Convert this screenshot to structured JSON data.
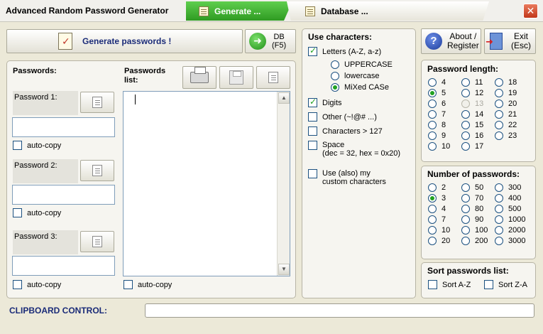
{
  "title": "Advanced Random Password Generator",
  "tabs": [
    {
      "label": "Generate ...",
      "active": true
    },
    {
      "label": "Database ...",
      "active": false
    }
  ],
  "toolbar": {
    "generate_label": "Generate passwords !",
    "db_line1": "DB",
    "db_line2": "(F5)",
    "about_line1": "About /",
    "about_line2": "Register",
    "exit_line1": "Exit",
    "exit_line2": "(Esc)"
  },
  "passwords": {
    "heading": "Passwords:",
    "list_heading_line1": "Passwords",
    "list_heading_line2": "list:",
    "items": [
      {
        "label": "Password 1:",
        "value": "",
        "autocopy_label": "auto-copy",
        "autocopy": false
      },
      {
        "label": "Password 2:",
        "value": "",
        "autocopy_label": "auto-copy",
        "autocopy": false
      },
      {
        "label": "Password 3:",
        "value": "",
        "autocopy_label": "auto-copy",
        "autocopy": false
      }
    ],
    "list_autocopy_label": "auto-copy",
    "list_text": ""
  },
  "use_chars": {
    "heading": "Use characters:",
    "letters": {
      "label": "Letters (A-Z, a-z)",
      "checked": true
    },
    "case_options": [
      {
        "label": "UPPERCASE",
        "selected": false
      },
      {
        "label": "lowercase",
        "selected": false
      },
      {
        "label": "MiXed CASe",
        "selected": true
      }
    ],
    "digits": {
      "label": "Digits",
      "checked": true
    },
    "other": {
      "label": "Other (~!@# ...)",
      "checked": false
    },
    "gt127": {
      "label": "Characters > 127",
      "checked": false
    },
    "space": {
      "label_line1": "Space",
      "label_line2": "(dec = 32, hex = 0x20)",
      "checked": false
    },
    "custom": {
      "label_line1": "Use (also) my",
      "label_line2": "custom characters",
      "checked": false
    }
  },
  "password_length": {
    "heading": "Password length:",
    "options": [
      {
        "label": "4",
        "selected": false,
        "disabled": false
      },
      {
        "label": "11",
        "selected": false,
        "disabled": false
      },
      {
        "label": "18",
        "selected": false,
        "disabled": false
      },
      {
        "label": "5",
        "selected": true,
        "disabled": false
      },
      {
        "label": "12",
        "selected": false,
        "disabled": false
      },
      {
        "label": "19",
        "selected": false,
        "disabled": false
      },
      {
        "label": "6",
        "selected": false,
        "disabled": false
      },
      {
        "label": "13",
        "selected": false,
        "disabled": true
      },
      {
        "label": "20",
        "selected": false,
        "disabled": false
      },
      {
        "label": "7",
        "selected": false,
        "disabled": false
      },
      {
        "label": "14",
        "selected": false,
        "disabled": false
      },
      {
        "label": "21",
        "selected": false,
        "disabled": false
      },
      {
        "label": "8",
        "selected": false,
        "disabled": false
      },
      {
        "label": "15",
        "selected": false,
        "disabled": false
      },
      {
        "label": "22",
        "selected": false,
        "disabled": false
      },
      {
        "label": "9",
        "selected": false,
        "disabled": false
      },
      {
        "label": "16",
        "selected": false,
        "disabled": false
      },
      {
        "label": "23",
        "selected": false,
        "disabled": false
      },
      {
        "label": "10",
        "selected": false,
        "disabled": false
      },
      {
        "label": "17",
        "selected": false,
        "disabled": false
      }
    ]
  },
  "number_of_passwords": {
    "heading": "Number of passwords:",
    "options": [
      {
        "label": "2",
        "selected": false
      },
      {
        "label": "50",
        "selected": false
      },
      {
        "label": "300",
        "selected": false
      },
      {
        "label": "3",
        "selected": true
      },
      {
        "label": "70",
        "selected": false
      },
      {
        "label": "400",
        "selected": false
      },
      {
        "label": "4",
        "selected": false
      },
      {
        "label": "80",
        "selected": false
      },
      {
        "label": "500",
        "selected": false
      },
      {
        "label": "7",
        "selected": false
      },
      {
        "label": "90",
        "selected": false
      },
      {
        "label": "1000",
        "selected": false
      },
      {
        "label": "10",
        "selected": false
      },
      {
        "label": "100",
        "selected": false
      },
      {
        "label": "2000",
        "selected": false
      },
      {
        "label": "20",
        "selected": false
      },
      {
        "label": "200",
        "selected": false
      },
      {
        "label": "3000",
        "selected": false
      }
    ]
  },
  "sort": {
    "heading": "Sort passwords list:",
    "az_label": "Sort A-Z",
    "za_label": "Sort Z-A",
    "az_checked": false,
    "za_checked": false
  },
  "clipboard": {
    "label": "CLIPBOARD CONTROL:",
    "value": ""
  },
  "colors": {
    "accent_green": "#2f9a22",
    "label_blue": "#1a2b78",
    "background": "#ece9d8"
  }
}
